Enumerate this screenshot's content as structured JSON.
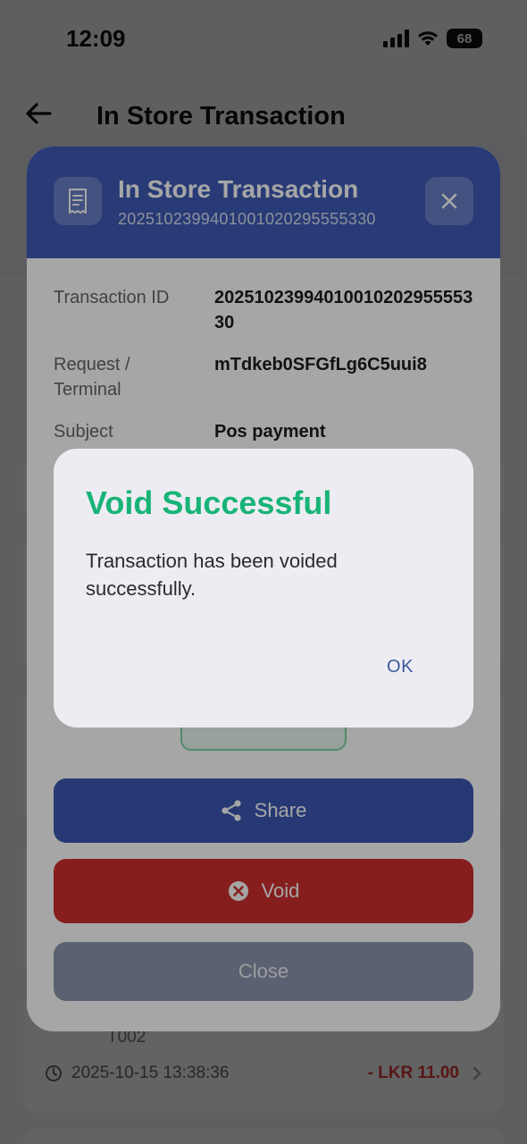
{
  "status_bar": {
    "time": "12:09",
    "battery": "68"
  },
  "app_bar": {
    "title": "In Store Transaction"
  },
  "background_list": {
    "item_terminal": "T002",
    "item_datetime": "2025-10-15 13:38:36",
    "item_amount": "- LKR 11.00"
  },
  "sheet": {
    "title": "In Store Transaction",
    "subtitle": "20251023994010010202955553​30",
    "details": [
      {
        "label": "Transaction ID",
        "value": "20251023994010010202955553​30"
      },
      {
        "label": "Request / Terminal",
        "value": "mTdkeb0SFGfLg6C5uui8"
      },
      {
        "label": "Subject",
        "value": "Pos payment"
      }
    ],
    "buttons": {
      "share": "Share",
      "void": "Void",
      "close": "Close"
    }
  },
  "dialog": {
    "title": "Void Successful",
    "message": "Transaction has been voided successfully.",
    "ok": "OK"
  },
  "colors": {
    "primary": "#3c58b3",
    "danger": "#cf2e2e",
    "success": "#18b477"
  }
}
